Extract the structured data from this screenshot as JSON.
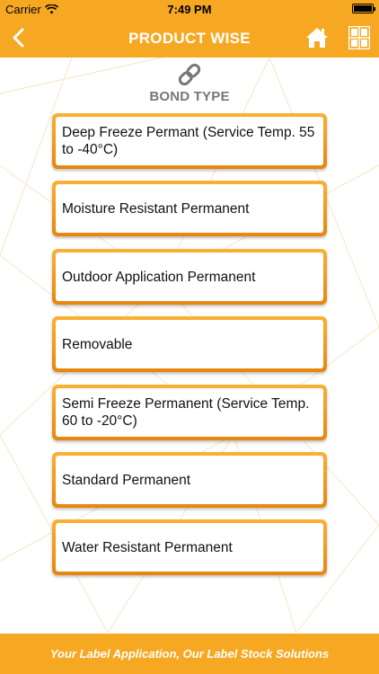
{
  "status_bar": {
    "carrier": "Carrier",
    "time": "7:49 PM"
  },
  "nav": {
    "title": "PRODUCT WISE",
    "icons": {
      "back": "chevron-left-icon",
      "home": "home-icon",
      "menu": "grid-icon"
    }
  },
  "section": {
    "title": "BOND TYPE",
    "icon": "link-icon"
  },
  "options": [
    "Deep Freeze Permant (Service Temp. 55 to -40°C)",
    "Moisture Resistant Permanent",
    "Outdoor Application Permanent",
    "Removable",
    "Semi Freeze Permanent (Service Temp. 60 to -20°C)",
    "Standard Permanent",
    "Water Resistant Permanent"
  ],
  "footer": {
    "tagline": "Your Label Application, Our Label Stock Solutions"
  },
  "colors": {
    "accent": "#f7a823",
    "button_dark": "#e8860c",
    "text": "#111111",
    "section_text": "#777777"
  }
}
